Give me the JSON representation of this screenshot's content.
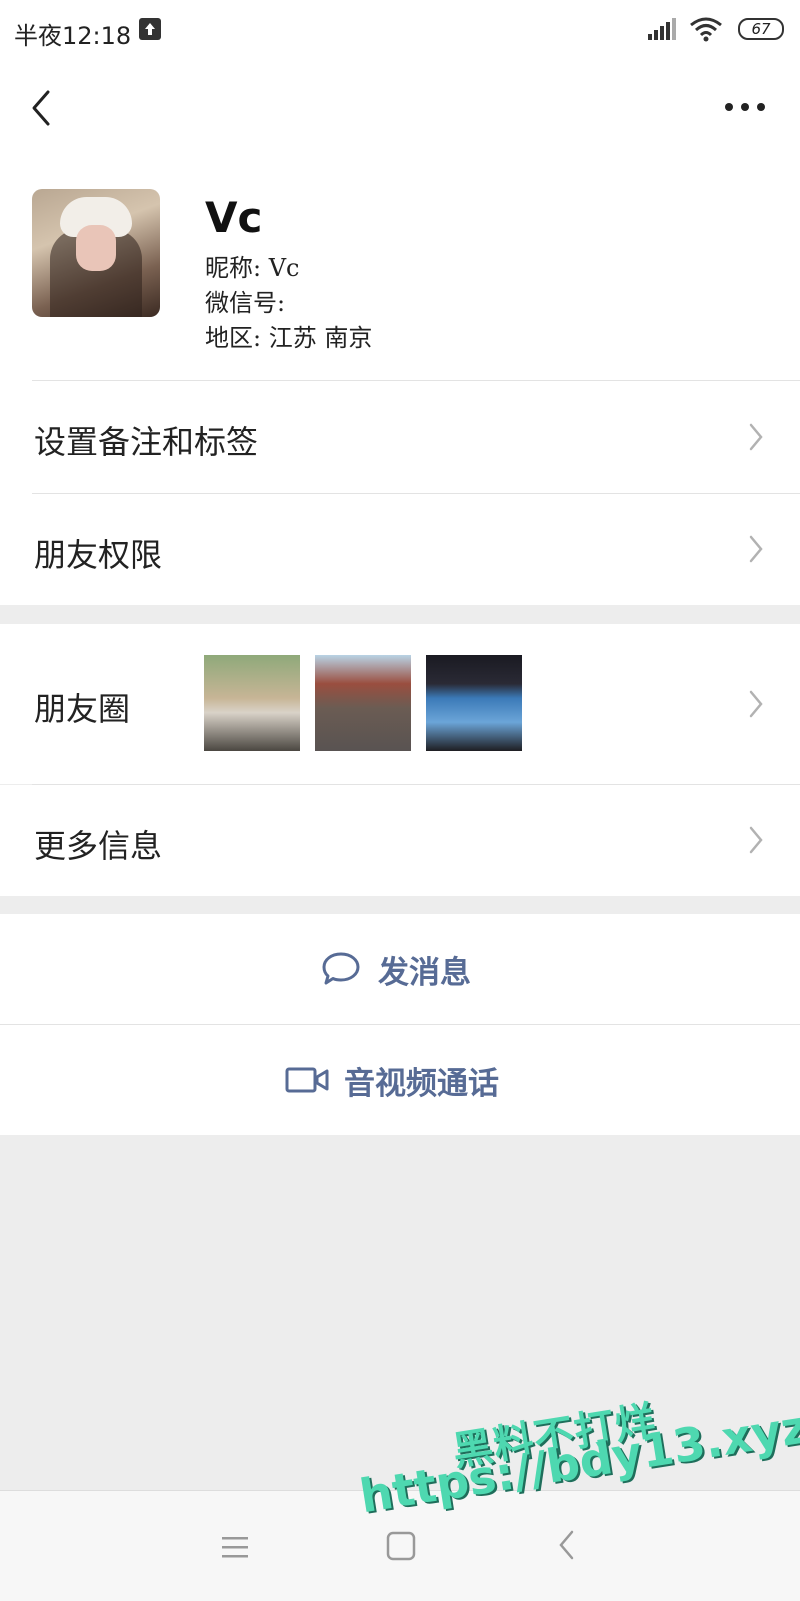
{
  "status_bar": {
    "time": "半夜12:18",
    "battery": "67",
    "icons": [
      "upload-icon",
      "signal-icon",
      "wifi-icon",
      "battery-icon"
    ]
  },
  "header": {
    "back_icon": "chevron-left-icon",
    "more_icon": "more-dots-icon"
  },
  "profile": {
    "name": "Vc",
    "nickname_line": "昵称: Vc",
    "wechat_id_label": "微信号:",
    "region_line": "地区: 江苏 南京"
  },
  "menu": {
    "remarks_tags": "设置备注和标签",
    "friend_permissions": "朋友权限",
    "moments": "朋友圈",
    "more_info": "更多信息"
  },
  "actions": {
    "send_message": "发消息",
    "video_call": "音视频通话"
  },
  "watermark": {
    "line1": "黑料不打烊",
    "line2": "https://bdy13.xyz"
  },
  "colors": {
    "accent": "#576b95",
    "background": "#ededed",
    "watermark": "#4ed8b0"
  }
}
